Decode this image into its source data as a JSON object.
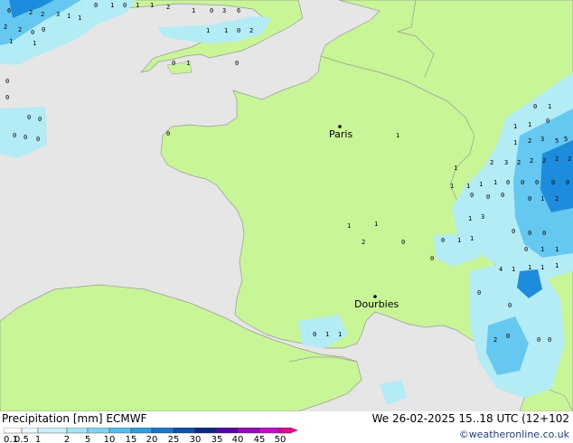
{
  "header": {
    "title": "Precipitation [mm] ECMWF",
    "datetime": "We 26-02-2025 15..18 UTC (12+102",
    "credit": "©weatheronline.co.uk"
  },
  "map": {
    "colors": {
      "sea": "#e6e6e6",
      "land": "#c8f596",
      "border": "#9a9a9a",
      "precip_light": "#b4ecf6",
      "precip_medium": "#64c8f0",
      "precip_heavy": "#1e8cdc"
    },
    "cities": [
      {
        "name": "Paris"
      },
      {
        "name": "Dourbies"
      }
    ],
    "precip_values": [
      "6",
      "2",
      "2",
      "3",
      "1",
      "1",
      "0",
      "1",
      "0",
      "1",
      "1",
      "2",
      "1",
      "0",
      "3",
      "6",
      "2",
      "2",
      "0",
      "0",
      "1",
      "1",
      "1",
      "1",
      "0",
      "2",
      "0",
      "1",
      "0",
      "0",
      "0",
      "0",
      "0",
      "0",
      "0",
      "0",
      "0",
      "1",
      "1",
      "1",
      "0",
      "0",
      "1",
      "1",
      "2",
      "3",
      "5",
      "5",
      "2",
      "3",
      "2",
      "2",
      "2",
      "2",
      "2",
      "1",
      "1",
      "1",
      "1",
      "1",
      "0",
      "0",
      "0",
      "0",
      "0",
      "0",
      "0",
      "0",
      "0",
      "1",
      "2",
      "1",
      "3",
      "1",
      "1",
      "2",
      "0",
      "0",
      "1",
      "1",
      "0",
      "0",
      "0",
      "0",
      "0",
      "1",
      "1",
      "4",
      "1",
      "1",
      "1",
      "1",
      "0",
      "0",
      "0",
      "1",
      "1",
      "2",
      "0",
      "0",
      "0",
      "0"
    ]
  },
  "legend": {
    "ticks": [
      "0.1",
      "0.5",
      "1",
      "2",
      "5",
      "10",
      "15",
      "20",
      "25",
      "30",
      "35",
      "40",
      "45",
      "50"
    ],
    "colors": [
      "#ffffff",
      "#e6f8fc",
      "#c8f0fa",
      "#a0e6f8",
      "#78d6f4",
      "#50c0f0",
      "#28a0e6",
      "#1478d2",
      "#0a50b4",
      "#0a288c",
      "#5a00b4",
      "#a000c8",
      "#d200d2",
      "#e600b4",
      "#f0008c"
    ]
  }
}
